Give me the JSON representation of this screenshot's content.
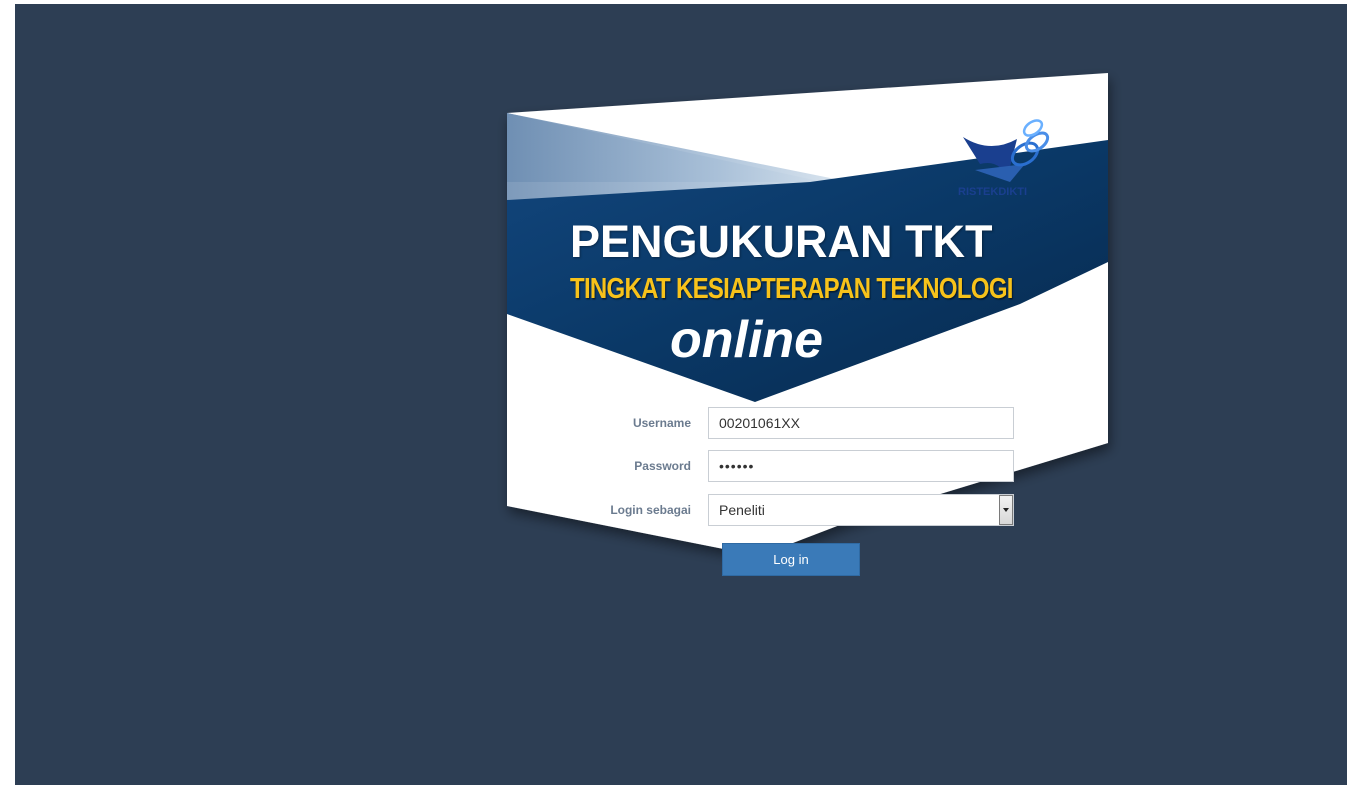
{
  "banner": {
    "logo_text": "RISTEKDIKTI",
    "title": "PENGUKURAN TKT",
    "subtitle": "TINGKAT KESIAPTERAPAN TEKNOLOGI",
    "tagline": "online"
  },
  "login_form": {
    "username_label": "Username",
    "username_value": "00201061XX",
    "password_label": "Password",
    "password_value": "••••••",
    "role_label": "Login sebagai",
    "role_selected": "Peneliti",
    "submit_label": "Log in"
  },
  "colors": {
    "background": "#2d3e54",
    "banner_dark_blue": "#0d3f73",
    "banner_light_blue": "#7a9cbf",
    "title_white": "#ffffff",
    "subtitle_yellow": "#f7c21a",
    "button_blue": "#3a7ab8"
  },
  "icons": {
    "logo": "ristekdikti-logo-icon",
    "select_arrow": "chevron-down-icon"
  }
}
